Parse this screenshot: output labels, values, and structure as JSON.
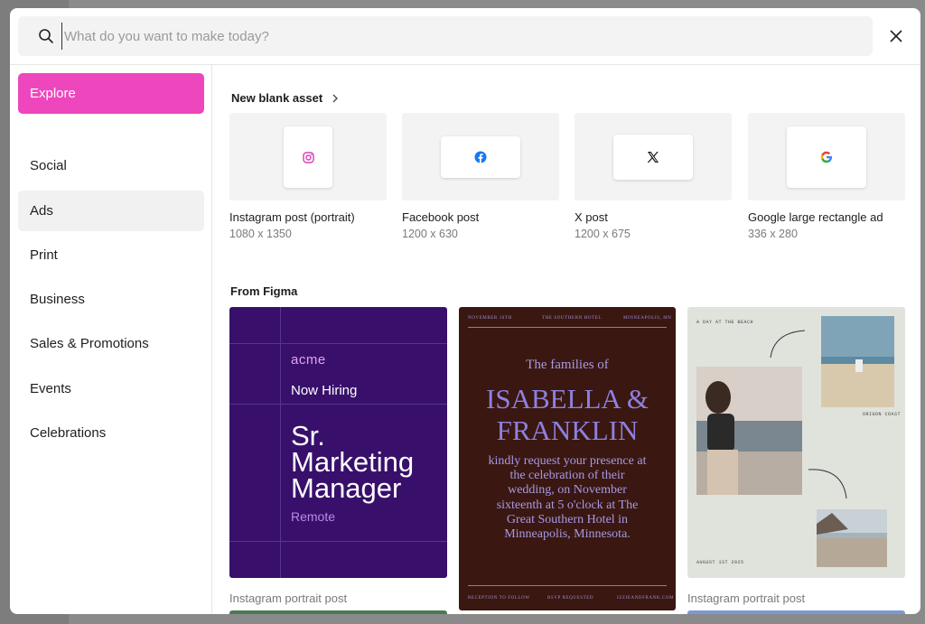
{
  "search": {
    "placeholder": "What do you want to make today?",
    "value": ""
  },
  "sidebar": {
    "items": [
      {
        "label": "Explore"
      },
      {
        "label": "Social"
      },
      {
        "label": "Ads"
      },
      {
        "label": "Print"
      },
      {
        "label": "Business"
      },
      {
        "label": "Sales & Promotions"
      },
      {
        "label": "Events"
      },
      {
        "label": "Celebrations"
      }
    ],
    "active": "Ads"
  },
  "blank_assets": {
    "title": "New blank asset",
    "items": [
      {
        "name": "Instagram post (portrait)",
        "size": "1080 x 1350",
        "icon": "instagram-icon"
      },
      {
        "name": "Facebook post",
        "size": "1200 x 630",
        "icon": "facebook-icon"
      },
      {
        "name": "X post",
        "size": "1200 x 675",
        "icon": "x-icon"
      },
      {
        "name": "Google large rectangle ad",
        "size": "336 x 280",
        "icon": "google-icon"
      }
    ]
  },
  "figma": {
    "title": "From Figma",
    "templates": [
      {
        "caption": "Instagram portrait post",
        "logo": "acme",
        "heading": "Now Hiring",
        "role": "Sr. Marketing Manager",
        "location": "Remote"
      },
      {
        "caption": "",
        "top_left": "NOVEMBER 16TH",
        "top_mid": "THE SOUTHERN HOTEL",
        "top_right": "MINNEAPOLIS, MN",
        "intro": "The families of",
        "names": "ISABELLA & FRANKLIN",
        "body": "kindly request your presence at the celebration of their wedding, on November sixteenth at 5 o'clock at The Great Southern Hotel in Minneapolis, Minnesota.",
        "bottom_left": "RECEPTION TO FOLLOW",
        "bottom_mid": "RSVP REQUESTED",
        "bottom_right": "IZZIEANDFRANK.COM"
      },
      {
        "caption": "Instagram portrait post",
        "top_text": "A DAY AT THE BEACH",
        "place": "ORIGON COAST",
        "date": "AUGUST 1ST 2025"
      }
    ]
  },
  "colors": {
    "accent": "#ee46bc",
    "acme_bg": "#38106b",
    "wedding_bg": "#3a1710",
    "wedding_text": "#8d80e0"
  }
}
